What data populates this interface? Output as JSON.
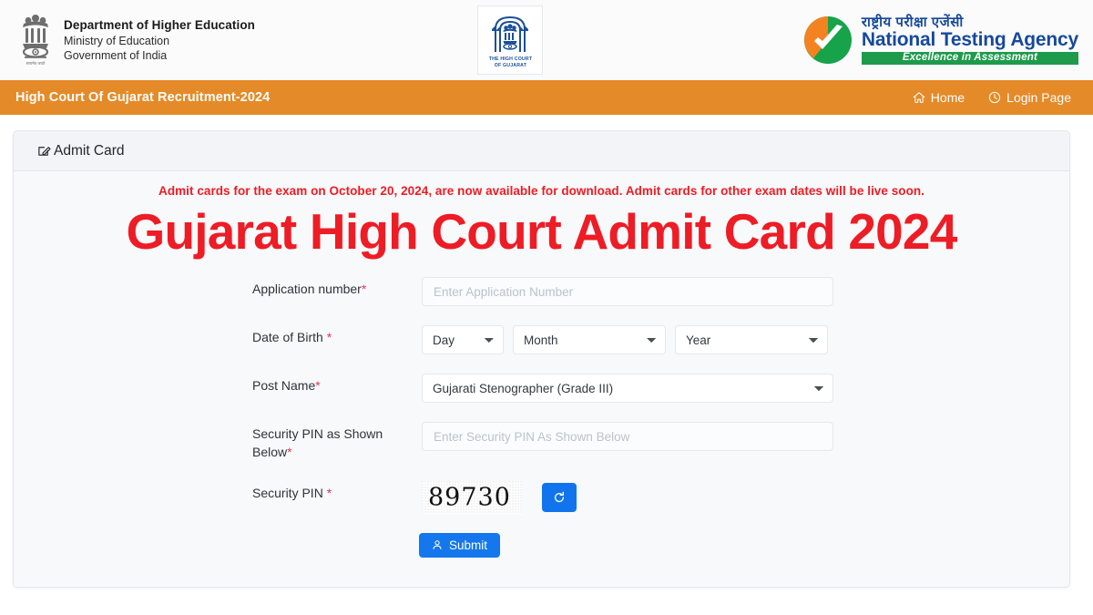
{
  "header": {
    "left_logo": {
      "icon": "ashoka-emblem-icon",
      "line1": "Department of Higher Education",
      "line2": "Ministry of Education",
      "line3": "Government of India"
    },
    "center_logo": {
      "icon": "high-court-of-gujarat-emblem-icon",
      "caption_line1": "THE HIGH COURT",
      "caption_line2": "OF GUJARAT"
    },
    "right_logo": {
      "icon": "nta-checkmark-icon",
      "hindi": "राष्ट्रीय परीक्षा एजेंसी",
      "english": "National Testing Agency",
      "tagline": "Excellence in Assessment"
    }
  },
  "navbar": {
    "title": "High Court Of Gujarat Recruitment-2024",
    "links": [
      {
        "label": "Home",
        "icon": "home-icon"
      },
      {
        "label": "Login Page",
        "icon": "clock-icon"
      }
    ],
    "background_color": "#e58a28"
  },
  "card": {
    "header_title": "Admit Card",
    "header_icon": "edit-square-icon",
    "notice": "Admit cards for the exam on October 20, 2024, are now available for download. Admit cards for other exam dates will be live soon.",
    "notice_color": "#ef1b23",
    "headline": "Gujarat High Court Admit Card 2024",
    "headline_color": "#ee1c25"
  },
  "form": {
    "application_number": {
      "label": "Application number",
      "required_mark": "*",
      "placeholder": "Enter Application Number",
      "value": ""
    },
    "date_of_birth": {
      "label": "Date of Birth ",
      "required_mark": "*",
      "day": "Day",
      "month": "Month",
      "year": "Year"
    },
    "post_name": {
      "label": "Post Name",
      "required_mark": "*",
      "value": "Gujarati Stenographer (Grade III)"
    },
    "security_pin_input": {
      "label": "Security PIN as Shown Below",
      "required_mark": "*",
      "placeholder": "Enter Security PIN As Shown Below",
      "value": ""
    },
    "security_pin_captcha": {
      "label": "Security PIN ",
      "required_mark": "*",
      "captcha_text": "89730",
      "refresh_icon": "refresh-icon"
    },
    "submit": {
      "label": "Submit",
      "icon": "user-icon",
      "color": "#1477ed"
    }
  }
}
